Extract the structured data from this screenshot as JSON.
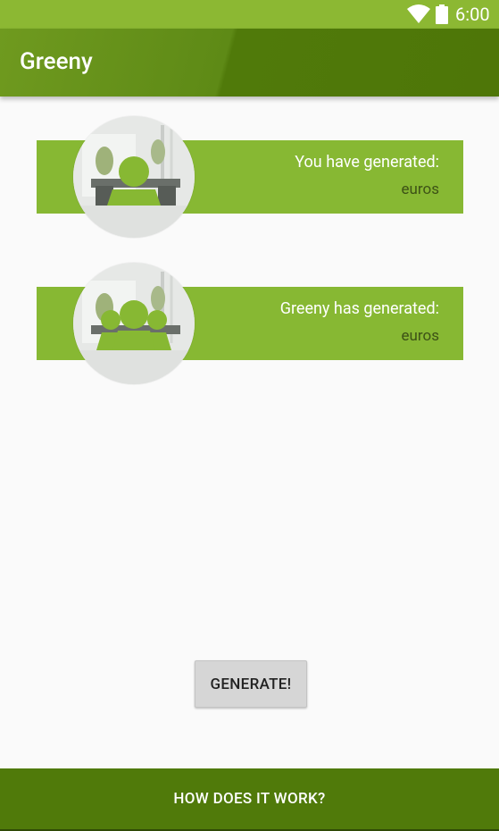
{
  "status_bar": {
    "time": "6:00",
    "icons": [
      "wifi-icon",
      "battery-icon"
    ]
  },
  "app_bar": {
    "title": "Greeny"
  },
  "cards": [
    {
      "line1": "You have generated:",
      "line2": "euros",
      "avatar": "single-person-office-icon"
    },
    {
      "line1": "Greeny has generated:",
      "line2": "euros",
      "avatar": "group-people-office-icon"
    }
  ],
  "generate_button": {
    "label": "GENERATE!"
  },
  "bottom_bar": {
    "label": "HOW DOES IT WORK?"
  },
  "colors": {
    "status_bar": "#8cb833",
    "app_bar": "#4e7608",
    "card": "#87b833",
    "bottom_bar": "#507a0a",
    "background": "#fafafa"
  }
}
